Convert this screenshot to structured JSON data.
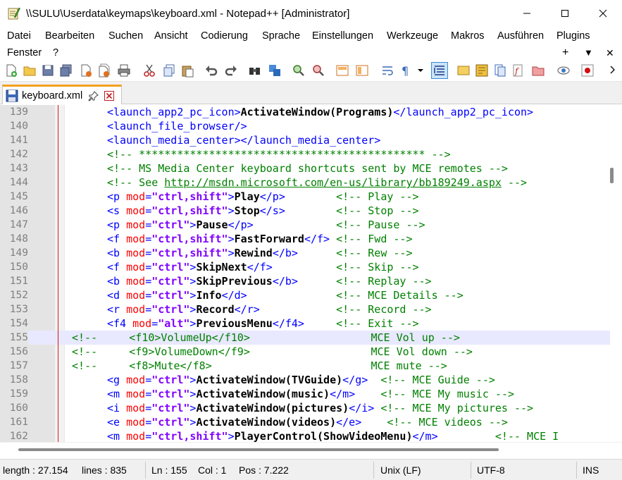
{
  "window": {
    "title": "\\\\SULU\\Userdata\\keymaps\\keyboard.xml - Notepad++ [Administrator]",
    "icon": "notepad-plus-plus-icon"
  },
  "menu": [
    {
      "label": "Datei"
    },
    {
      "label": "Bearbeiten"
    },
    {
      "label": "Suchen"
    },
    {
      "label": "Ansicht"
    },
    {
      "label": "Codierung"
    },
    {
      "label": "Sprache"
    },
    {
      "label": "Einstellungen"
    },
    {
      "label": "Werkzeuge"
    },
    {
      "label": "Makros"
    },
    {
      "label": "Ausführen"
    },
    {
      "label": "Plugins"
    },
    {
      "label": "Fenster"
    },
    {
      "label": "?"
    },
    {
      "label": "+"
    },
    {
      "label": "▼"
    },
    {
      "label": "✕"
    }
  ],
  "tab": {
    "label": "keyboard.xml"
  },
  "status": {
    "length": "length : 27.154",
    "lines": "lines : 835",
    "ln": "Ln : 155",
    "col": "Col : 1",
    "pos": "Pos : 7.222",
    "eol": "Unix (LF)",
    "encoding": "UTF-8",
    "mode": "INS"
  },
  "colors": {
    "tag": "#0000ff",
    "attribute": "#ff0000",
    "attribute_value": "#8000ff",
    "comment": "#008000",
    "current_line": "#e8e8ff",
    "tab_accent": "#f5a01e"
  },
  "lines": [
    {
      "num": "139",
      "segs": [
        [
          "t",
          "<launch_app2_pc_icon>"
        ],
        [
          "b",
          "ActivateWindow(Programs)"
        ],
        [
          "t",
          "</launch_app2_pc_icon>"
        ]
      ]
    },
    {
      "num": "140",
      "segs": [
        [
          "t",
          "<launch_file_browser/>"
        ]
      ]
    },
    {
      "num": "141",
      "segs": [
        [
          "t",
          "<launch_media_center></launch_media_center>"
        ]
      ]
    },
    {
      "num": "142",
      "segs": [
        [
          "c",
          "<!-- ********************************************* -->"
        ]
      ]
    },
    {
      "num": "143",
      "segs": [
        [
          "c",
          "<!-- MS Media Center keyboard shortcuts sent by MCE remotes -->"
        ]
      ]
    },
    {
      "num": "144",
      "segs": [
        [
          "c",
          "<!-- See "
        ],
        [
          "url",
          "http://msdn.microsoft.com/en-us/library/bb189249.aspx"
        ],
        [
          "c",
          " -->"
        ]
      ]
    },
    {
      "num": "145",
      "segs": [
        [
          "t",
          "<p "
        ],
        [
          "a",
          "mod"
        ],
        [
          "t",
          "="
        ],
        [
          "v",
          "\"ctrl,shift\""
        ],
        [
          "t",
          ">"
        ],
        [
          "b",
          "Play"
        ],
        [
          "t",
          "</p>"
        ],
        [
          "txt",
          "        "
        ],
        [
          "c",
          "<!-- Play -->"
        ]
      ]
    },
    {
      "num": "146",
      "segs": [
        [
          "t",
          "<s "
        ],
        [
          "a",
          "mod"
        ],
        [
          "t",
          "="
        ],
        [
          "v",
          "\"ctrl,shift\""
        ],
        [
          "t",
          ">"
        ],
        [
          "b",
          "Stop"
        ],
        [
          "t",
          "</s>"
        ],
        [
          "txt",
          "        "
        ],
        [
          "c",
          "<!-- Stop -->"
        ]
      ]
    },
    {
      "num": "147",
      "segs": [
        [
          "t",
          "<p "
        ],
        [
          "a",
          "mod"
        ],
        [
          "t",
          "="
        ],
        [
          "v",
          "\"ctrl\""
        ],
        [
          "t",
          ">"
        ],
        [
          "b",
          "Pause"
        ],
        [
          "t",
          "</p>"
        ],
        [
          "txt",
          "             "
        ],
        [
          "c",
          "<!-- Pause -->"
        ]
      ]
    },
    {
      "num": "148",
      "segs": [
        [
          "t",
          "<f "
        ],
        [
          "a",
          "mod"
        ],
        [
          "t",
          "="
        ],
        [
          "v",
          "\"ctrl,shift\""
        ],
        [
          "t",
          ">"
        ],
        [
          "b",
          "FastForward"
        ],
        [
          "t",
          "</f>"
        ],
        [
          "txt",
          " "
        ],
        [
          "c",
          "<!-- Fwd -->"
        ]
      ]
    },
    {
      "num": "149",
      "segs": [
        [
          "t",
          "<b "
        ],
        [
          "a",
          "mod"
        ],
        [
          "t",
          "="
        ],
        [
          "v",
          "\"ctrl,shift\""
        ],
        [
          "t",
          ">"
        ],
        [
          "b",
          "Rewind"
        ],
        [
          "t",
          "</b>"
        ],
        [
          "txt",
          "      "
        ],
        [
          "c",
          "<!-- Rew -->"
        ]
      ]
    },
    {
      "num": "150",
      "segs": [
        [
          "t",
          "<f "
        ],
        [
          "a",
          "mod"
        ],
        [
          "t",
          "="
        ],
        [
          "v",
          "\"ctrl\""
        ],
        [
          "t",
          ">"
        ],
        [
          "b",
          "SkipNext"
        ],
        [
          "t",
          "</f>"
        ],
        [
          "txt",
          "          "
        ],
        [
          "c",
          "<!-- Skip -->"
        ]
      ]
    },
    {
      "num": "151",
      "segs": [
        [
          "t",
          "<b "
        ],
        [
          "a",
          "mod"
        ],
        [
          "t",
          "="
        ],
        [
          "v",
          "\"ctrl\""
        ],
        [
          "t",
          ">"
        ],
        [
          "b",
          "SkipPrevious"
        ],
        [
          "t",
          "</b>"
        ],
        [
          "txt",
          "      "
        ],
        [
          "c",
          "<!-- Replay -->"
        ]
      ]
    },
    {
      "num": "152",
      "segs": [
        [
          "t",
          "<d "
        ],
        [
          "a",
          "mod"
        ],
        [
          "t",
          "="
        ],
        [
          "v",
          "\"ctrl\""
        ],
        [
          "t",
          ">"
        ],
        [
          "b",
          "Info"
        ],
        [
          "t",
          "</d>"
        ],
        [
          "txt",
          "              "
        ],
        [
          "c",
          "<!-- MCE Details -->"
        ]
      ]
    },
    {
      "num": "153",
      "segs": [
        [
          "t",
          "<r "
        ],
        [
          "a",
          "mod"
        ],
        [
          "t",
          "="
        ],
        [
          "v",
          "\"ctrl\""
        ],
        [
          "t",
          ">"
        ],
        [
          "b",
          "Record"
        ],
        [
          "t",
          "</r>"
        ],
        [
          "txt",
          "            "
        ],
        [
          "c",
          "<!-- Record -->"
        ]
      ]
    },
    {
      "num": "154",
      "segs": [
        [
          "t",
          "<f4 "
        ],
        [
          "a",
          "mod"
        ],
        [
          "t",
          "="
        ],
        [
          "v",
          "\"alt\""
        ],
        [
          "t",
          ">"
        ],
        [
          "b",
          "PreviousMenu"
        ],
        [
          "t",
          "</f4>"
        ],
        [
          "txt",
          "     "
        ],
        [
          "c",
          "<!-- Exit -->"
        ]
      ]
    },
    {
      "num": "155",
      "current": true,
      "indent": "",
      "segs": [
        [
          "c",
          "<!--     <f10>VolumeUp</f10>                   MCE Vol up -->"
        ]
      ]
    },
    {
      "num": "156",
      "indent": "",
      "segs": [
        [
          "c",
          "<!--     <f9>VolumeDown</f9>                   MCE Vol down -->"
        ]
      ]
    },
    {
      "num": "157",
      "indent": "",
      "segs": [
        [
          "c",
          "<!--     <f8>Mute</f8>                         MCE mute -->"
        ]
      ]
    },
    {
      "num": "158",
      "segs": [
        [
          "t",
          "<g "
        ],
        [
          "a",
          "mod"
        ],
        [
          "t",
          "="
        ],
        [
          "v",
          "\"ctrl\""
        ],
        [
          "t",
          ">"
        ],
        [
          "b",
          "ActivateWindow(TVGuide)"
        ],
        [
          "t",
          "</g>"
        ],
        [
          "txt",
          "  "
        ],
        [
          "c",
          "<!-- MCE Guide -->"
        ]
      ]
    },
    {
      "num": "159",
      "segs": [
        [
          "t",
          "<m "
        ],
        [
          "a",
          "mod"
        ],
        [
          "t",
          "="
        ],
        [
          "v",
          "\"ctrl\""
        ],
        [
          "t",
          ">"
        ],
        [
          "b",
          "ActivateWindow(music)"
        ],
        [
          "t",
          "</m>"
        ],
        [
          "txt",
          "    "
        ],
        [
          "c",
          "<!-- MCE My music -->"
        ]
      ]
    },
    {
      "num": "160",
      "segs": [
        [
          "t",
          "<i "
        ],
        [
          "a",
          "mod"
        ],
        [
          "t",
          "="
        ],
        [
          "v",
          "\"ctrl\""
        ],
        [
          "t",
          ">"
        ],
        [
          "b",
          "ActivateWindow(pictures)"
        ],
        [
          "t",
          "</i>"
        ],
        [
          "txt",
          " "
        ],
        [
          "c",
          "<!-- MCE My pictures -->"
        ]
      ]
    },
    {
      "num": "161",
      "segs": [
        [
          "t",
          "<e "
        ],
        [
          "a",
          "mod"
        ],
        [
          "t",
          "="
        ],
        [
          "v",
          "\"ctrl\""
        ],
        [
          "t",
          ">"
        ],
        [
          "b",
          "ActivateWindow(videos)"
        ],
        [
          "t",
          "</e>"
        ],
        [
          "txt",
          "    "
        ],
        [
          "c",
          "<!-- MCE videos -->"
        ]
      ]
    },
    {
      "num": "162",
      "segs": [
        [
          "t",
          "<m "
        ],
        [
          "a",
          "mod"
        ],
        [
          "t",
          "="
        ],
        [
          "v",
          "\"ctrl,shift\""
        ],
        [
          "t",
          ">"
        ],
        [
          "b",
          "PlayerControl(ShowVideoMenu)"
        ],
        [
          "t",
          "</m>"
        ],
        [
          "txt",
          "         "
        ],
        [
          "c",
          "<!-- MCE I"
        ]
      ]
    }
  ]
}
